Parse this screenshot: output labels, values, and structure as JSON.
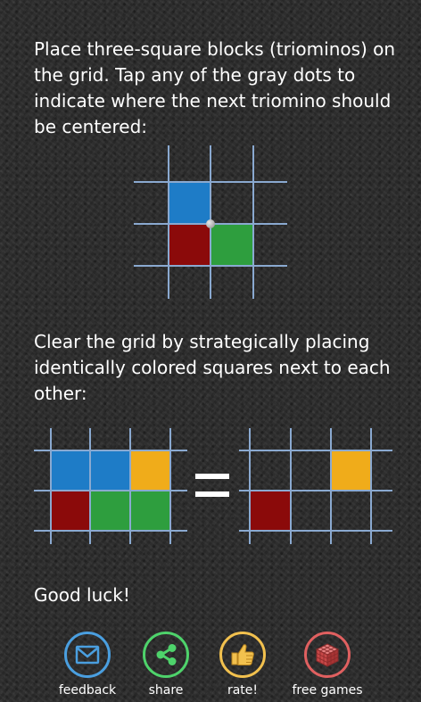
{
  "instructions": {
    "intro": "Place three-square blocks (triominos) on the grid. Tap any of the gray dots to indicate where the next triomino should be centered:",
    "clear": "Clear the grid by strategically placing identically colored squares next to each other:",
    "closing": "Good luck!"
  },
  "colors": {
    "blue": "#1e7cc7",
    "red": "#8b0a0a",
    "green": "#2e9e3e",
    "yellow": "#f0ac1a",
    "grid_line": "#8aa9d0",
    "feedback_accent": "#4a9fe0",
    "share_accent": "#4ed36b",
    "rate_accent": "#f2c14e",
    "free_games_accent": "#e06060"
  },
  "diagrams": {
    "placement_example": {
      "cells": [
        {
          "row": 0,
          "col": 0,
          "color": "blue"
        },
        {
          "row": 1,
          "col": 0,
          "color": "red"
        },
        {
          "row": 1,
          "col": 1,
          "color": "green"
        }
      ],
      "dot": {
        "row_line": 1,
        "col_line": 1
      }
    },
    "before_clear": {
      "cells": [
        {
          "row": 0,
          "col": 0,
          "color": "blue"
        },
        {
          "row": 0,
          "col": 1,
          "color": "blue"
        },
        {
          "row": 0,
          "col": 2,
          "color": "yellow"
        },
        {
          "row": 1,
          "col": 0,
          "color": "red"
        },
        {
          "row": 1,
          "col": 1,
          "color": "green"
        },
        {
          "row": 1,
          "col": 2,
          "color": "green"
        }
      ]
    },
    "after_clear": {
      "cells": [
        {
          "row": 0,
          "col": 2,
          "color": "yellow"
        },
        {
          "row": 1,
          "col": 0,
          "color": "red"
        }
      ]
    }
  },
  "toolbar": {
    "feedback": {
      "label": "feedback",
      "icon": "envelope-icon"
    },
    "share": {
      "label": "share",
      "icon": "share-icon"
    },
    "rate": {
      "label": "rate!",
      "icon": "thumbs-up-icon"
    },
    "free_games": {
      "label": "free games",
      "icon": "cube-icon"
    }
  }
}
